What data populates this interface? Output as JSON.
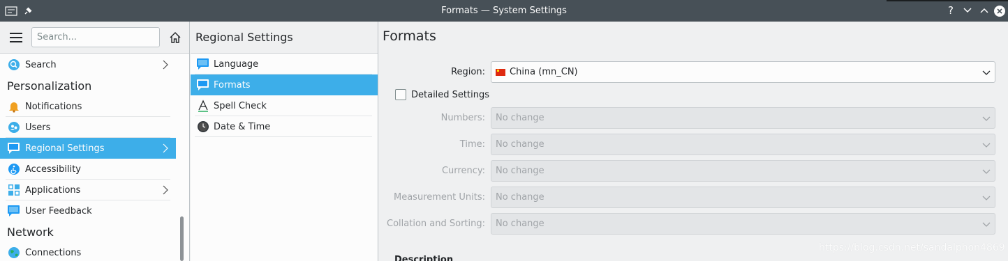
{
  "window": {
    "title": "Formats — System Settings",
    "controls": {
      "help": "?",
      "minimize": "chevron-down",
      "maximize": "chevron-up",
      "close": "close"
    }
  },
  "sidebar": {
    "search_placeholder": "Search...",
    "items": [
      {
        "label": "Search",
        "icon": "search-icon",
        "chevron": true,
        "selected": false
      },
      {
        "section": "Personalization"
      },
      {
        "label": "Notifications",
        "icon": "bell-icon",
        "chevron": false,
        "selected": false
      },
      {
        "label": "Users",
        "icon": "users-icon",
        "chevron": false,
        "selected": false
      },
      {
        "label": "Regional Settings",
        "icon": "regional-icon",
        "chevron": true,
        "selected": true
      },
      {
        "label": "Accessibility",
        "icon": "accessibility-icon",
        "chevron": false,
        "selected": false
      },
      {
        "label": "Applications",
        "icon": "applications-icon",
        "chevron": true,
        "selected": false
      },
      {
        "label": "User Feedback",
        "icon": "feedback-icon",
        "chevron": false,
        "selected": false
      },
      {
        "section": "Network"
      },
      {
        "label": "Connections",
        "icon": "globe-icon",
        "chevron": false,
        "selected": false
      }
    ]
  },
  "middle": {
    "title": "Regional Settings",
    "items": [
      {
        "label": "Language",
        "icon": "language-icon",
        "selected": false
      },
      {
        "label": "Formats",
        "icon": "formats-icon",
        "selected": true
      },
      {
        "label": "Spell Check",
        "icon": "spellcheck-icon",
        "selected": false
      },
      {
        "label": "Date & Time",
        "icon": "clock-icon",
        "selected": false
      }
    ]
  },
  "content": {
    "title": "Formats",
    "region": {
      "label": "Region:",
      "value": "China (mn_CN)"
    },
    "detailed": {
      "label": "Detailed Settings",
      "checked": false
    },
    "fields": [
      {
        "label": "Numbers:",
        "value": "No change"
      },
      {
        "label": "Time:",
        "value": "No change"
      },
      {
        "label": "Currency:",
        "value": "No change"
      },
      {
        "label": "Measurement Units:",
        "value": "No change"
      },
      {
        "label": "Collation and Sorting:",
        "value": "No change"
      }
    ],
    "description_label": "Description",
    "watermark": "https://blog.csdn.net/sandalphon4869"
  },
  "colors": {
    "accent": "#3daee9",
    "titlebar": "#475057",
    "window_bg": "#eff0f1",
    "view_bg": "#fcfcfc"
  }
}
